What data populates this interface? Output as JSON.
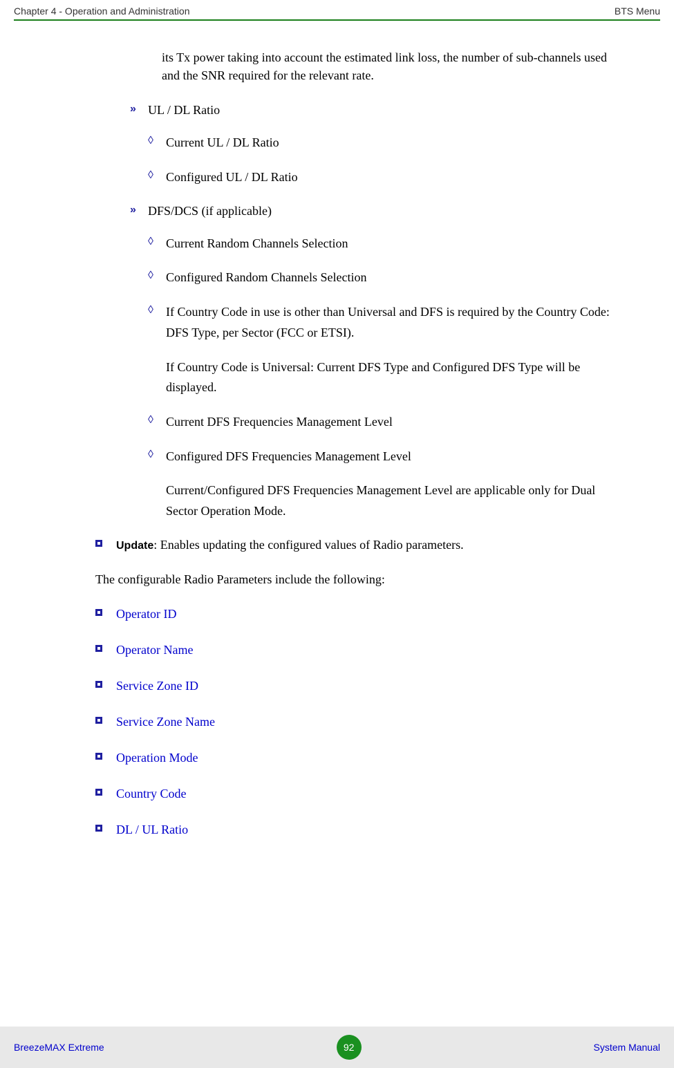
{
  "header": {
    "left": "Chapter 4 - Operation and Administration",
    "right": "BTS Menu"
  },
  "content": {
    "continuation": "its Tx power taking into account the estimated link loss, the number of sub-channels used and the SNR required for the relevant rate.",
    "sub_bullets": [
      {
        "label": "UL / DL Ratio",
        "items": [
          "Current UL / DL Ratio",
          "Configured UL / DL Ratio"
        ]
      },
      {
        "label": "DFS/DCS (if applicable)",
        "items": [
          "Current Random Channels Selection",
          "Configured Random Channels Selection",
          "If Country Code in use is other than Universal and DFS is required by the Country Code: DFS Type, per Sector (FCC or ETSI).",
          "Current DFS Frequencies Management Level",
          "Configured DFS Frequencies Management Level"
        ],
        "continuations": {
          "2": "If Country Code is Universal: Current DFS Type and Configured DFS Type will be displayed.",
          "4": "Current/Configured DFS Frequencies Management Level are applicable only for Dual Sector Operation Mode."
        }
      }
    ],
    "update_bold": "Update",
    "update_text": ": Enables updating the configured values of Radio parameters.",
    "plain_text": "The configurable Radio Parameters include the following:",
    "blue_links": [
      "Operator ID",
      "Operator Name",
      "Service Zone ID",
      "Service Zone Name",
      "Operation Mode",
      "Country Code",
      "DL / UL Ratio"
    ]
  },
  "footer": {
    "left": "BreezeMAX Extreme",
    "page": "92",
    "right": "System Manual"
  }
}
